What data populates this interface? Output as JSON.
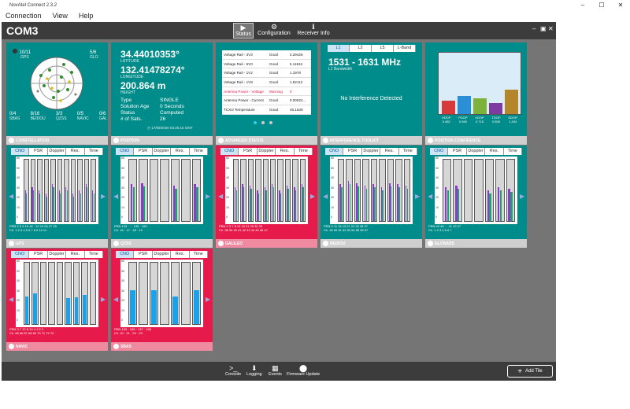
{
  "window": {
    "title": "NovAtel Connect 2.3.2"
  },
  "menu": [
    "Connection",
    "View",
    "Help"
  ],
  "header": {
    "port": "COM3",
    "nav": [
      {
        "label": "Status",
        "icon": "play-icon"
      },
      {
        "label": "Configuration",
        "icon": "gear-icon"
      },
      {
        "label": "Receiver Info",
        "icon": "info-icon"
      }
    ]
  },
  "constellation": {
    "title": "CONSTELLATION",
    "gps": "10/11",
    "gps_label": "GPS",
    "glo": "5/6",
    "glo_label": "GLO",
    "sbas": "0/4",
    "sbas_label": "SBAS",
    "beidou": "8/16",
    "beidou_label": "BEIDOU",
    "qzss": "3/3",
    "qzss_label": "QZSS",
    "navic": "0/5",
    "navic_label": "NAVIC",
    "gal": "0/6",
    "gal_label": "GAL"
  },
  "position": {
    "title": "POSITION",
    "latitude": "34.44010353°",
    "lat_label": "LATITUDE",
    "longitude": "132.41478274°",
    "lon_label": "LONGITUDE",
    "height": "200.864 m",
    "height_label": "HEIGHT",
    "rows": [
      {
        "k": "Type",
        "v": "SINGLE"
      },
      {
        "k": "Solution Age",
        "v": "0 Seconds"
      },
      {
        "k": "Status",
        "v": "Computed"
      },
      {
        "k": "# of Sats.",
        "v": "26"
      }
    ],
    "timestamp": "17/09/2020 03:26:16 GMT"
  },
  "advanced": {
    "title": "ADVANCED STATUS",
    "rows": [
      {
        "name": "Voltage Rail - 3V3",
        "status": "Good",
        "value": "3.29426",
        "warn": false
      },
      {
        "name": "Voltage Rail - 5V0",
        "status": "Good",
        "value": "5.11844",
        "warn": false
      },
      {
        "name": "Voltage Rail - 1V2",
        "status": "Good",
        "value": "1.1978",
        "warn": false
      },
      {
        "name": "Voltage Rail - 1V8",
        "status": "Good",
        "value": "1.82112",
        "warn": false
      },
      {
        "name": "Antenna Power - Voltage",
        "status": "Warning",
        "value": "0",
        "warn": true
      },
      {
        "name": "Antenna Power - Current",
        "status": "Good",
        "value": "0.00024...",
        "warn": false
      },
      {
        "name": "TCXO Temperature",
        "status": "Good",
        "value": "46.1539",
        "warn": false
      }
    ]
  },
  "interference": {
    "title": "INTERFERENCE TOOLKIT",
    "tabs": [
      "L1",
      "L2",
      "L5",
      "L-Band"
    ],
    "range": "1531 - 1631 MHz",
    "bandwidth": "L1 Bandwidth",
    "message": "No Interference Detected"
  },
  "confidence": {
    "title": "POSITION CONFIDENCE",
    "bars": [
      {
        "label": "HDOP",
        "value": "0.482",
        "level": 0.22,
        "color": "#d63a3a"
      },
      {
        "label": "PDOP",
        "value": "0.945",
        "level": 0.3,
        "color": "#2a8fd6"
      },
      {
        "label": "VDOP",
        "value": "0.718",
        "level": 0.25,
        "color": "#7cb23c"
      },
      {
        "label": "TDOP",
        "value": "0.508",
        "level": 0.18,
        "color": "#7d3aa0"
      },
      {
        "label": "GDOP",
        "value": "1.404",
        "level": 0.4,
        "color": "#b5852a"
      }
    ]
  },
  "sig_tabs": [
    "CNO",
    "PSR",
    "Doppler",
    "Res.",
    "Time"
  ],
  "signal_tiles": [
    {
      "name": "GPS",
      "prn": "PRN 2 5 9 15 18 · 12 13 26 27 29",
      "ch": "Ch. 1 2 3 4 5 6 7 8 9 10 11",
      "red": false
    },
    {
      "name": "QZSS",
      "prn": "PRN 193 · · · 195 · 199",
      "ch": "Ch. 16 · 17 · 18 · 19",
      "red": false
    },
    {
      "name": "GALILEO",
      "prn": "PRN 2 3 7 8 13 15 21 26 30 33",
      "ch": "Ch. 38 39 40 41 42 43 44 45 46 47",
      "red": true
    },
    {
      "name": "BEIDOU",
      "prn": "PRN 6 11 16 19 21 22 29 35 37",
      "ch": "Ch. 49 50 51 52 53 54 55 56 57",
      "red": false
    },
    {
      "name": "GLONASS",
      "prn": "PRN 43 46 · · 41 42 47",
      "ch": "Ch. 1 2 3 4 5 6 7",
      "red": false
    },
    {
      "name": "NAVIC",
      "prn": "PRN 3 7 12 8 10 4 1 5 2",
      "ch": "Ch. 65 66 67 68 69 70 71 72 73",
      "red": true
    },
    {
      "name": "SBAS",
      "prn": "PRN 183 · 189 · 137 · 185",
      "ch": "Ch. 20 · 21 · 22 · 23",
      "red": true
    }
  ],
  "bottom": [
    "Console",
    "Logging",
    "Events",
    "Firmware Update"
  ],
  "add_tile": "Add Tile"
}
